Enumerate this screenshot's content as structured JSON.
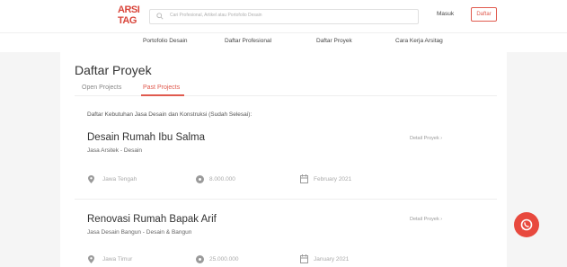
{
  "header": {
    "logo_line1": "ARSI",
    "logo_line2": "TAG",
    "search_placeholder": "Cari Profesional, Artikel atau Portofolio Desain",
    "login_label": "Masuk",
    "register_label": "Daftar"
  },
  "nav": {
    "items": [
      {
        "label": "Portofolio Desain"
      },
      {
        "label": "Daftar Profesional"
      },
      {
        "label": "Daftar Proyek"
      },
      {
        "label": "Cara Kerja Arsitag"
      }
    ]
  },
  "main": {
    "title": "Daftar Proyek",
    "tabs": [
      {
        "label": "Open Projects",
        "active": false
      },
      {
        "label": "Past Projects",
        "active": true
      }
    ],
    "description": "Daftar Kebutuhan Jasa Desain dan Konstruksi (Sudah Selesai):",
    "detail_label": "Detail Proyek ›",
    "projects": [
      {
        "title": "Desain Rumah Ibu Salma",
        "service": "Jasa Arsitek - Desain",
        "location": "Jawa Tengah",
        "budget": "8.000.000",
        "date": "February 2021"
      },
      {
        "title": "Renovasi Rumah Bapak Arif",
        "service": "Jasa Desain Bangun - Desain & Bangun",
        "location": "Jawa Timur",
        "budget": "25.000.000",
        "date": "January 2021"
      }
    ]
  },
  "colors": {
    "accent": "#e05a4e",
    "fab": "#e8493e",
    "background": "#f5f5f5"
  },
  "icons": {
    "search": "search-icon",
    "location": "map-pin-icon",
    "budget": "money-icon",
    "date": "calendar-icon",
    "chat": "whatsapp-icon"
  }
}
